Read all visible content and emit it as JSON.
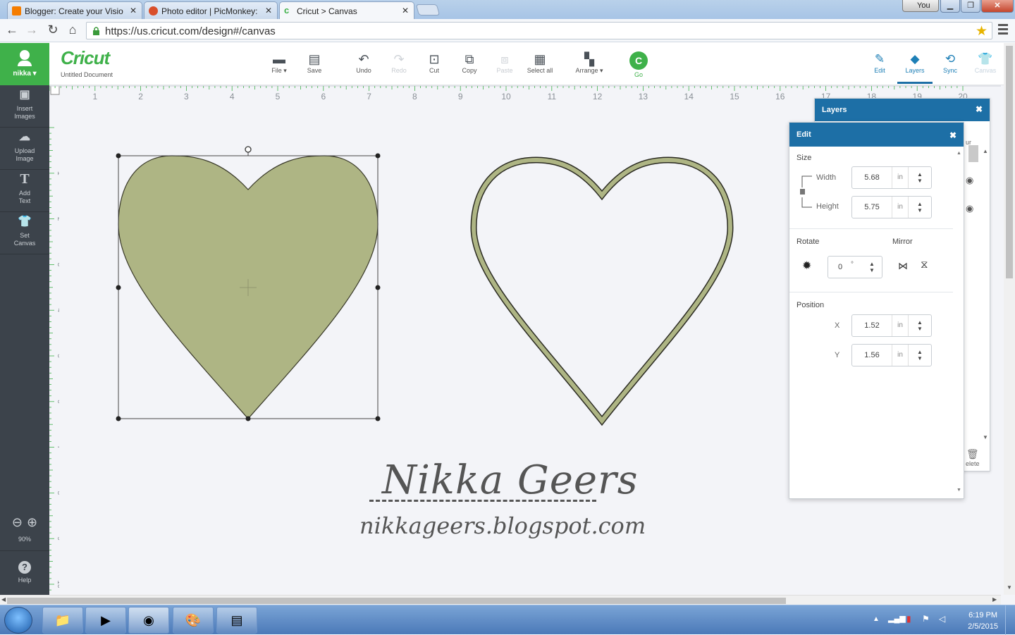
{
  "browser": {
    "tabs": [
      {
        "title": "Blogger: Create your Visio",
        "favicon": "blogger-icon",
        "color": "#f57d00"
      },
      {
        "title": "Photo editor | PicMonkey:",
        "favicon": "picmonkey-icon",
        "color": "#d94f2b"
      },
      {
        "title": "Cricut > Canvas",
        "favicon": "cricut-icon",
        "color": "#3fb14a"
      }
    ],
    "user_label": "You",
    "url": "https://us.cricut.com/design#/canvas"
  },
  "sidebar": {
    "user": "nikka ▾",
    "items": [
      {
        "label": "Insert\nImages",
        "icon": "image-icon"
      },
      {
        "label": "Upload\nImage",
        "icon": "cloud-upload-icon"
      },
      {
        "label": "Add\nText",
        "icon": "text-icon"
      },
      {
        "label": "Set\nCanvas",
        "icon": "shirt-icon"
      }
    ],
    "zoom": "90%",
    "help": "Help"
  },
  "toolbar": {
    "logo": "Cricut",
    "document": "Untitled Document",
    "tools": [
      {
        "label": "File ▾",
        "icon": "folder-icon",
        "enabled": true
      },
      {
        "label": "Save",
        "icon": "save-icon",
        "enabled": true
      },
      {
        "label": "Undo",
        "icon": "undo-icon",
        "enabled": true
      },
      {
        "label": "Redo",
        "icon": "redo-icon",
        "enabled": false
      },
      {
        "label": "Cut",
        "icon": "cut-icon",
        "enabled": true
      },
      {
        "label": "Copy",
        "icon": "copy-icon",
        "enabled": true
      },
      {
        "label": "Paste",
        "icon": "paste-icon",
        "enabled": false
      },
      {
        "label": "Select all",
        "icon": "select-all-icon",
        "enabled": true
      },
      {
        "label": "Arrange ▾",
        "icon": "arrange-icon",
        "enabled": true
      },
      {
        "label": "Go",
        "icon": "go-icon",
        "enabled": true
      }
    ],
    "right_tools": [
      {
        "label": "Edit",
        "icon": "edit-icon",
        "state": "normal"
      },
      {
        "label": "Layers",
        "icon": "layers-icon",
        "state": "active"
      },
      {
        "label": "Sync",
        "icon": "sync-icon",
        "state": "normal"
      },
      {
        "label": "Canvas",
        "icon": "canvas-shirt-icon",
        "state": "disabled"
      }
    ]
  },
  "rulers": {
    "horizontal": [
      "1",
      "2",
      "3",
      "4",
      "5",
      "6",
      "7",
      "8",
      "9",
      "10",
      "11",
      "12",
      "13",
      "14",
      "15",
      "16",
      "17",
      "18",
      "19",
      "20"
    ],
    "vertical": [
      "1",
      "2",
      "3",
      "4",
      "5",
      "6",
      "7",
      "8",
      "9",
      "10",
      "11"
    ]
  },
  "canvas": {
    "fill_color": "#aeb584",
    "outline_color": "#aeb584",
    "watermark_name": "Nikka Geers",
    "watermark_url": "nikkageers.blogspot.com"
  },
  "layers_panel": {
    "title": "Layers",
    "partial_text": "ur",
    "delete_label": "elete"
  },
  "edit_panel": {
    "title": "Edit",
    "size_label": "Size",
    "width_label": "Width",
    "width_value": "5.68",
    "height_label": "Height",
    "height_value": "5.75",
    "unit": "in",
    "rotate_label": "Rotate",
    "rotate_value": "0",
    "rotate_unit": "°",
    "mirror_label": "Mirror",
    "position_label": "Position",
    "x_label": "X",
    "x_value": "1.52",
    "y_label": "Y",
    "y_value": "1.56"
  },
  "taskbar": {
    "apps": [
      "explorer-icon",
      "media-player-icon",
      "chrome-icon",
      "paint-icon",
      "wordpad-icon"
    ],
    "time": "6:19 PM",
    "date": "2/5/2015"
  }
}
